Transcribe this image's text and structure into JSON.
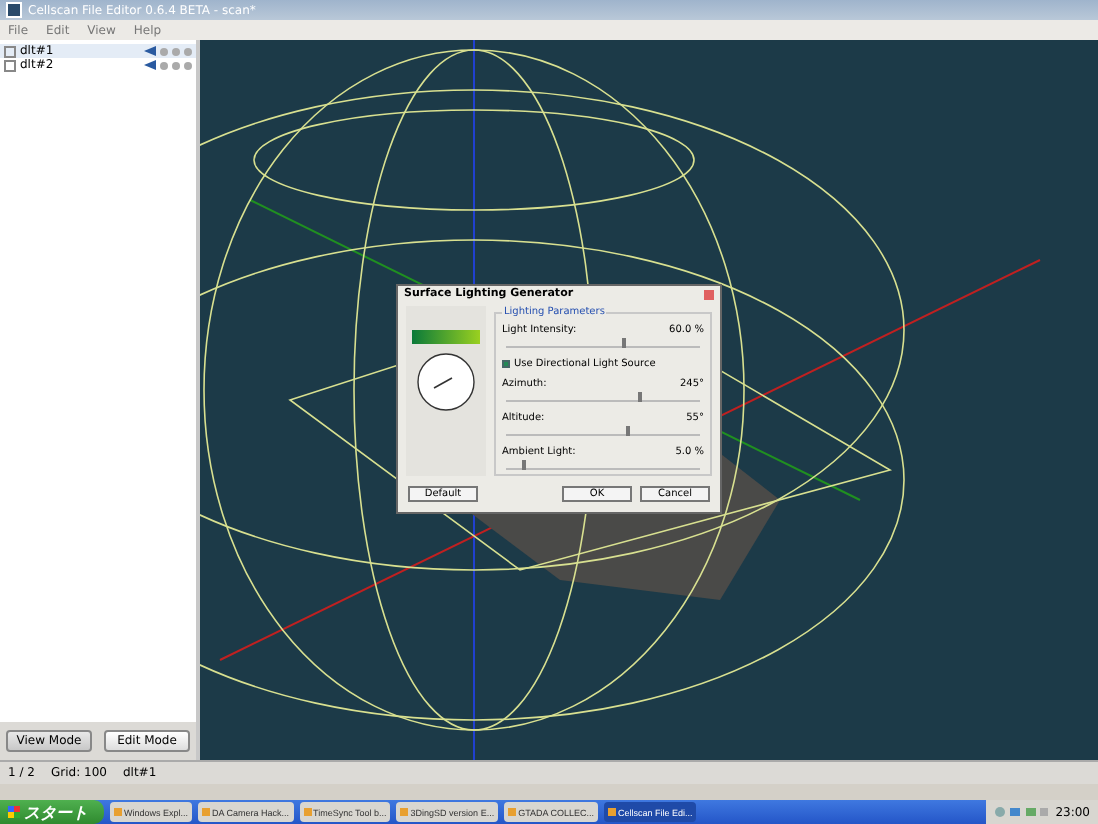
{
  "window": {
    "title": "Cellscan File Editor 0.6.4 BETA - scan*"
  },
  "menu": [
    "File",
    "Edit",
    "View",
    "Help"
  ],
  "layers": [
    {
      "name": "dlt#1",
      "selected": true
    },
    {
      "name": "dlt#2",
      "selected": false
    }
  ],
  "mode_buttons": [
    {
      "label": "View Mode",
      "selected": true
    },
    {
      "label": "Edit Mode",
      "selected": false
    }
  ],
  "status_bar": [
    "1 / 2",
    "Grid: 100",
    "dlt#1"
  ],
  "dialog": {
    "title": "Surface Lighting Generator",
    "group": "Lighting Parameters",
    "sliders": [
      {
        "kind": "slider",
        "label": "Light Intensity:",
        "reading": "60.0 %",
        "level": 0.6
      },
      {
        "kind": "checkbox",
        "label": "Use Directional Light Source",
        "checked": true
      },
      {
        "kind": "slider",
        "label": "Azimuth:",
        "reading": "245°",
        "level": 0.68
      },
      {
        "kind": "slider",
        "label": "Altitude:",
        "reading": "55°",
        "level": 0.62
      },
      {
        "kind": "slider",
        "label": "Ambient Light:",
        "reading": "5.0 %",
        "level": 0.08
      }
    ],
    "buttons": [
      "Default",
      "OK",
      "Cancel"
    ]
  },
  "taskbar": {
    "start": "スタート",
    "items": [
      {
        "label": "Windows Expl...",
        "selected": false
      },
      {
        "label": "DA Camera Hack...",
        "selected": false
      },
      {
        "label": "TimeSync Tool b...",
        "selected": false
      },
      {
        "label": "3DingSD version E...",
        "selected": false
      },
      {
        "label": "GTADA COLLEC...",
        "selected": false
      },
      {
        "label": "Cellscan File Edi...",
        "selected": true
      }
    ],
    "clock": "23:00"
  }
}
